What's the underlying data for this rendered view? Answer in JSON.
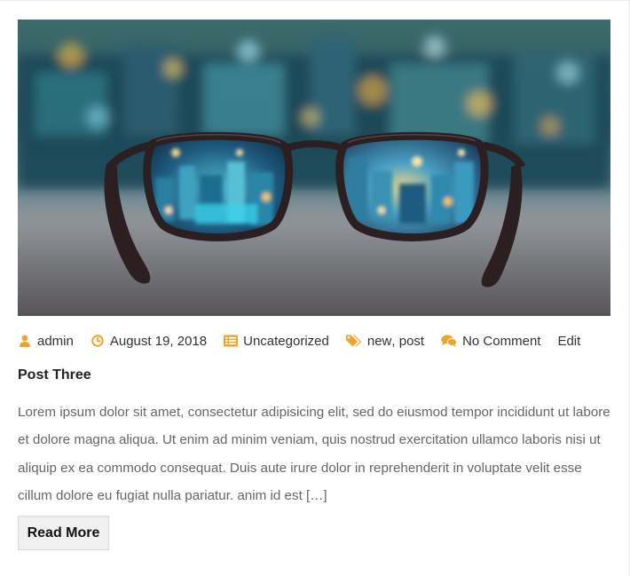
{
  "colors": {
    "accent": "#f0a32b",
    "text": "#333333",
    "excerpt_text": "#666666",
    "button_bg": "#f0f0f0"
  },
  "post": {
    "image_alt": "Eyeglasses on a table looking at a blurred night city skyline",
    "meta": {
      "author_icon": "user-icon",
      "author": "admin",
      "date_icon": "clock-icon",
      "date": "August 19, 2018",
      "category_icon": "list-icon",
      "category": "Uncategorized",
      "tags_icon": "tags-icon",
      "tags": [
        "new",
        "post"
      ],
      "tag_separator": ",",
      "comments_icon": "comments-icon",
      "comments": "No Comment",
      "edit": "Edit"
    },
    "title": "Post Three",
    "excerpt": "Lorem ipsum dolor sit amet, consectetur adipisicing elit, sed do eiusmod tempor incididunt ut labore et dolore magna aliqua. Ut enim ad minim veniam, quis nostrud exercitation ullamco laboris nisi ut aliquip ex ea commodo consequat. Duis aute irure dolor in reprehenderit in voluptate velit esse cillum dolore eu fugiat nulla pariatur. anim id est […]",
    "read_more": "Read More"
  }
}
